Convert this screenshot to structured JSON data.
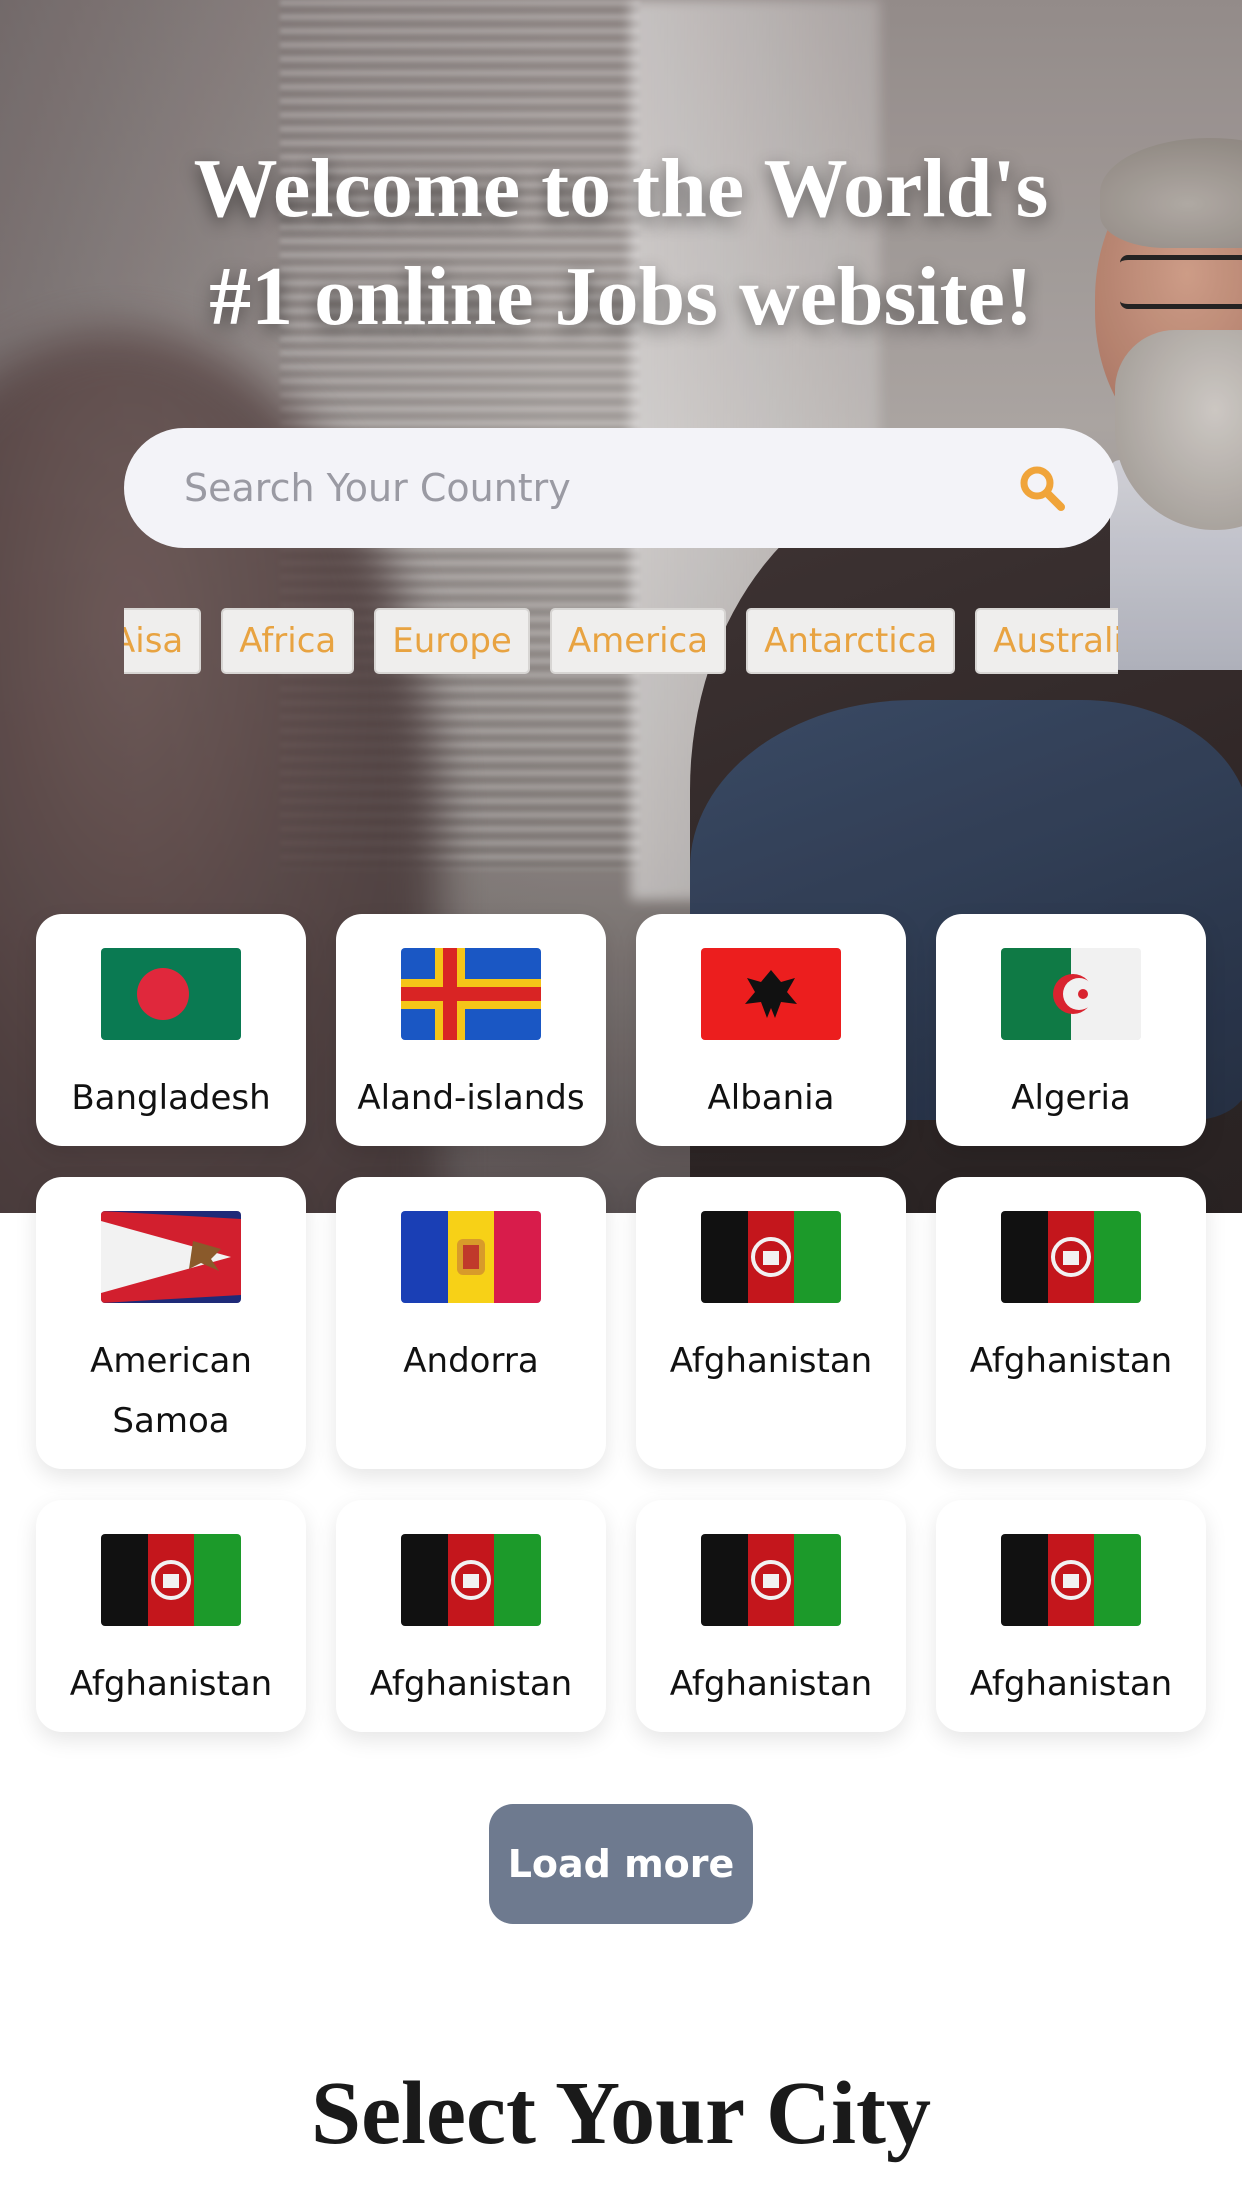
{
  "hero": {
    "title_line1": "Welcome to the World's",
    "title_line2": "#1 online Jobs website!"
  },
  "search": {
    "placeholder": "Search Your Country",
    "icon": "search-icon",
    "icon_color": "#f0a43a"
  },
  "continents": [
    "Aisa",
    "Africa",
    "Europe",
    "America",
    "Antarctica",
    "Australia"
  ],
  "countries": [
    {
      "name": "Bangladesh",
      "flag": "bangladesh-flag-icon"
    },
    {
      "name": "Aland-islands",
      "flag": "aland-islands-flag-icon"
    },
    {
      "name": "Albania",
      "flag": "albania-flag-icon"
    },
    {
      "name": "Algeria",
      "flag": "algeria-flag-icon"
    },
    {
      "name": "American Samoa",
      "flag": "american-samoa-flag-icon"
    },
    {
      "name": "Andorra",
      "flag": "andorra-flag-icon"
    },
    {
      "name": "Afghanistan",
      "flag": "afghanistan-flag-icon"
    },
    {
      "name": "Afghanistan",
      "flag": "afghanistan-flag-icon"
    },
    {
      "name": "Afghanistan",
      "flag": "afghanistan-flag-icon"
    },
    {
      "name": "Afghanistan",
      "flag": "afghanistan-flag-icon"
    },
    {
      "name": "Afghanistan",
      "flag": "afghanistan-flag-icon"
    },
    {
      "name": "Afghanistan",
      "flag": "afghanistan-flag-icon"
    }
  ],
  "load_more_label": "Load more",
  "city_section_title": "Select Your City",
  "colors": {
    "accent": "#e8a341",
    "button": "#6e7a8f"
  }
}
